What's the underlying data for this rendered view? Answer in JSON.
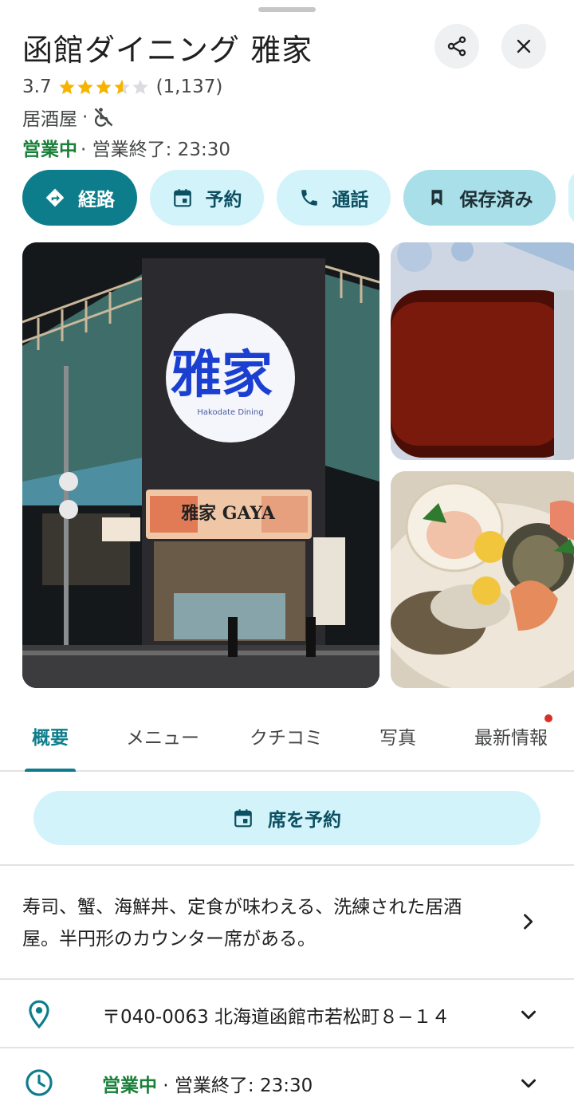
{
  "place": {
    "name": "函館ダイニング 雅家",
    "rating": "3.7",
    "review_count": "(1,137)",
    "rating_value": 3.7,
    "category": "居酒屋",
    "separator": "·",
    "accessibility_icon": "wheelchair-unavailable-icon",
    "open_status": "営業中",
    "closing_text": "· 営業終了: 23:30"
  },
  "header": {
    "share_icon": "share-icon",
    "close_icon": "close-icon"
  },
  "actions": [
    {
      "label": "経路",
      "icon": "directions-icon"
    },
    {
      "label": "予約",
      "icon": "calendar-icon"
    },
    {
      "label": "通話",
      "icon": "phone-icon"
    },
    {
      "label": "保存済み",
      "icon": "bookmark-icon"
    }
  ],
  "photos": {
    "main_sign_text": "雅家",
    "main_sign_subtitle": "Hakodate Dining",
    "main_banner_text": "雅家 GAYA"
  },
  "tabs": [
    {
      "label": "概要",
      "active": true
    },
    {
      "label": "メニュー"
    },
    {
      "label": "クチコミ"
    },
    {
      "label": "写真"
    },
    {
      "label": "最新情報",
      "notification": true
    }
  ],
  "reserve": {
    "label": "席を予約"
  },
  "description": "寿司、蟹、海鮮丼、定食が味わえる、洗練された居酒屋。半円形のカウンター席がある。",
  "address": "〒040-0063 北海道函館市若松町８−１４",
  "hours": {
    "status": "営業中",
    "detail": " · 営業終了: 23:30"
  },
  "colors": {
    "accent": "#0e7d8b",
    "accent_light": "#d3f3fb",
    "open_green": "#188038",
    "star": "#f6b400",
    "notification": "#d93025"
  }
}
